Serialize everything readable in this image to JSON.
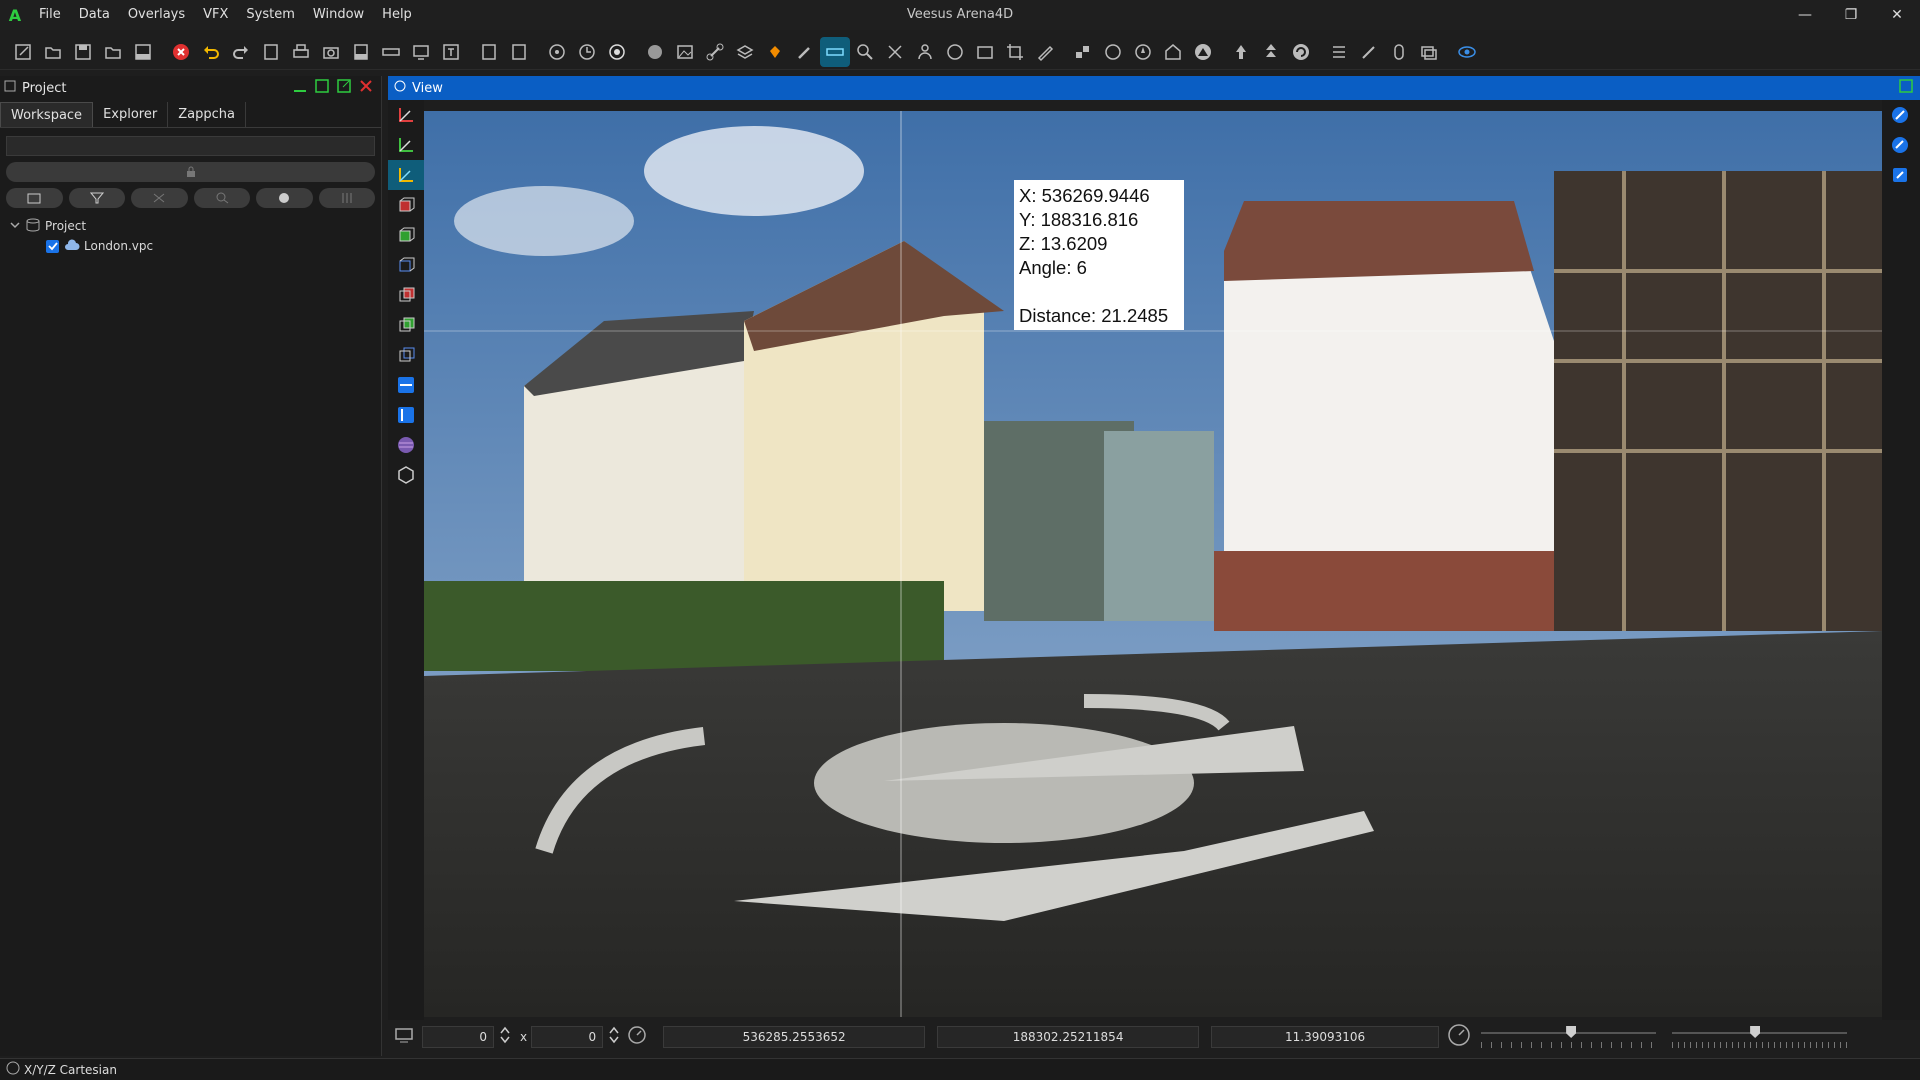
{
  "app": {
    "title": "Veesus Arena4D",
    "logo": "A"
  },
  "menu": [
    "File",
    "Data",
    "Overlays",
    "VFX",
    "System",
    "Window",
    "Help"
  ],
  "window_controls": {
    "minimize": "—",
    "restore": "❐",
    "close": "✕"
  },
  "left_panel": {
    "title": "Project",
    "tabs": [
      {
        "label": "Workspace",
        "active": true
      },
      {
        "label": "Explorer",
        "active": false
      },
      {
        "label": "Zappcha",
        "active": false
      }
    ],
    "tree": {
      "root_label": "Project",
      "child_label": "London.vpc",
      "child_checked": true
    }
  },
  "view": {
    "title": "View",
    "tooltip": {
      "x": "X: 536269.9446",
      "y": "Y: 188316.816",
      "z": "Z: 13.6209",
      "angle": "Angle: 6",
      "distance": "Distance: 21.2485"
    }
  },
  "bottom_bar": {
    "width_value": "0",
    "times": "x",
    "height_value": "0",
    "coord_x": "536285.2553652",
    "coord_y": "188302.25211854",
    "coord_z": "11.39093106"
  },
  "status": {
    "coordinate_system": "X/Y/Z Cartesian"
  },
  "colors": {
    "accent": "#0a5ec4",
    "logo": "#2ecc40",
    "close": "#e03030"
  }
}
